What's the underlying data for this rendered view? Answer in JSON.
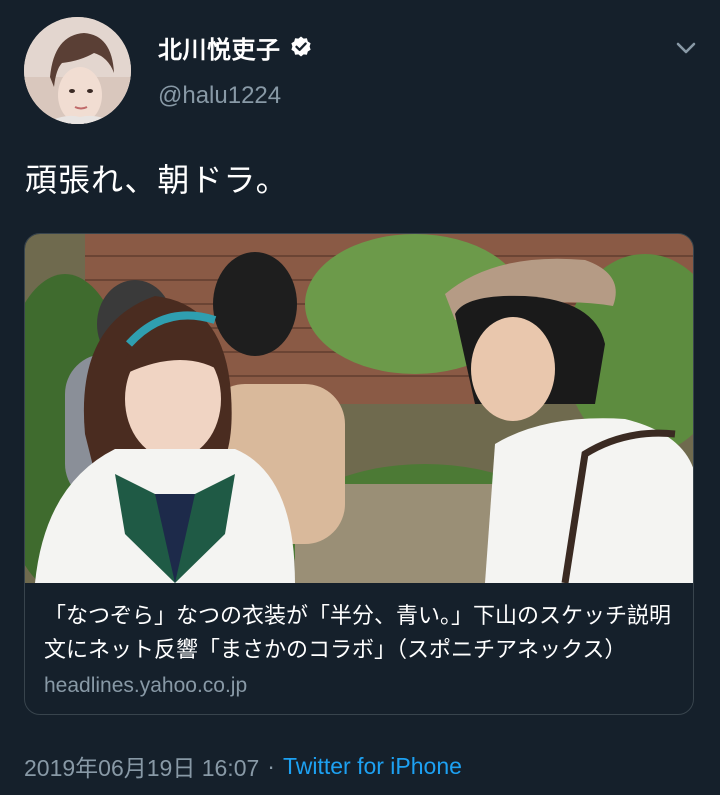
{
  "tweet": {
    "author": {
      "display_name": "北川悦吏子",
      "handle": "@halu1224",
      "verified": true
    },
    "text": "頑張れ、朝ドラ。",
    "card": {
      "title": "「なつぞら」なつの衣装が「半分、青い。」下山のスケッチ説明文にネット反響「まさかのコラボ」（スポニチアネックス）",
      "domain": "headlines.yahoo.co.jp"
    },
    "timestamp": "2019年06月19日 16:07",
    "separator": "·",
    "source": "Twitter for iPhone"
  },
  "icons": {
    "verified": "verified-badge-icon",
    "menu": "chevron-down-icon"
  },
  "colors": {
    "background": "#15202b",
    "secondary_text": "#8899a6",
    "link": "#1da1f2",
    "border": "#38444d"
  }
}
